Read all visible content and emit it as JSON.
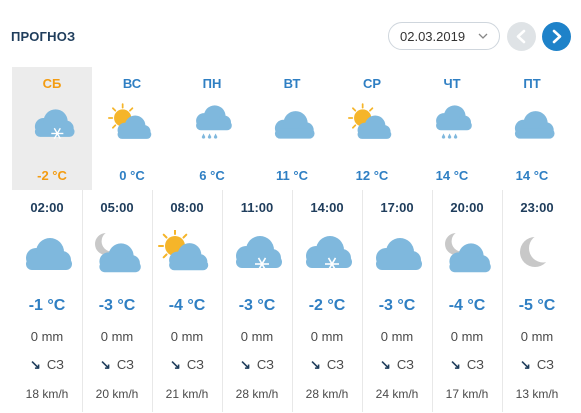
{
  "header": {
    "title": "ПРОГНОЗ",
    "date_value": "02.03.2019",
    "chevron_icon": "chevron-down-icon",
    "prev_icon": "chevron-left-icon",
    "next_icon": "chevron-right-icon"
  },
  "colors": {
    "accent": "#2f7fc3",
    "active": "#f39c12",
    "cloud": "#7fb8dd",
    "sun": "#f5b52a",
    "moon": "#c8c8c8"
  },
  "days": [
    {
      "name": "СБ",
      "temp": "-2 °C",
      "icon": "cloud-snow-icon",
      "active": true
    },
    {
      "name": "ВС",
      "temp": "0 °C",
      "icon": "sun-cloud-icon",
      "active": false
    },
    {
      "name": "ПН",
      "temp": "6 °C",
      "icon": "cloud-rain-icon",
      "active": false
    },
    {
      "name": "ВТ",
      "temp": "11 °C",
      "icon": "cloud-icon",
      "active": false
    },
    {
      "name": "СР",
      "temp": "12 °C",
      "icon": "sun-cloud-icon",
      "active": false
    },
    {
      "name": "ЧТ",
      "temp": "14 °C",
      "icon": "cloud-rain-icon",
      "active": false
    },
    {
      "name": "ПТ",
      "temp": "14 °C",
      "icon": "cloud-icon",
      "active": false
    }
  ],
  "hours": [
    {
      "time": "02:00",
      "temp": "-1 °C",
      "precip": "0 mm",
      "arrow": "↘",
      "dir": "СЗ",
      "speed": "18 km/h",
      "icon": "cloud-icon"
    },
    {
      "time": "05:00",
      "temp": "-3 °C",
      "precip": "0 mm",
      "arrow": "↘",
      "dir": "СЗ",
      "speed": "20 km/h",
      "icon": "moon-cloud-icon"
    },
    {
      "time": "08:00",
      "temp": "-4 °C",
      "precip": "0 mm",
      "arrow": "↘",
      "dir": "СЗ",
      "speed": "21 km/h",
      "icon": "sun-cloud-icon"
    },
    {
      "time": "11:00",
      "temp": "-3 °C",
      "precip": "0 mm",
      "arrow": "↘",
      "dir": "СЗ",
      "speed": "28 km/h",
      "icon": "cloud-snow-icon"
    },
    {
      "time": "14:00",
      "temp": "-2 °C",
      "precip": "0 mm",
      "arrow": "↘",
      "dir": "СЗ",
      "speed": "28 km/h",
      "icon": "cloud-snow-icon"
    },
    {
      "time": "17:00",
      "temp": "-3 °C",
      "precip": "0 mm",
      "arrow": "↘",
      "dir": "СЗ",
      "speed": "24 km/h",
      "icon": "cloud-icon"
    },
    {
      "time": "20:00",
      "temp": "-4 °C",
      "precip": "0 mm",
      "arrow": "↘",
      "dir": "СЗ",
      "speed": "17 km/h",
      "icon": "moon-cloud-icon"
    },
    {
      "time": "23:00",
      "temp": "-5 °C",
      "precip": "0 mm",
      "arrow": "↘",
      "dir": "СЗ",
      "speed": "13 km/h",
      "icon": "moon-icon"
    }
  ]
}
